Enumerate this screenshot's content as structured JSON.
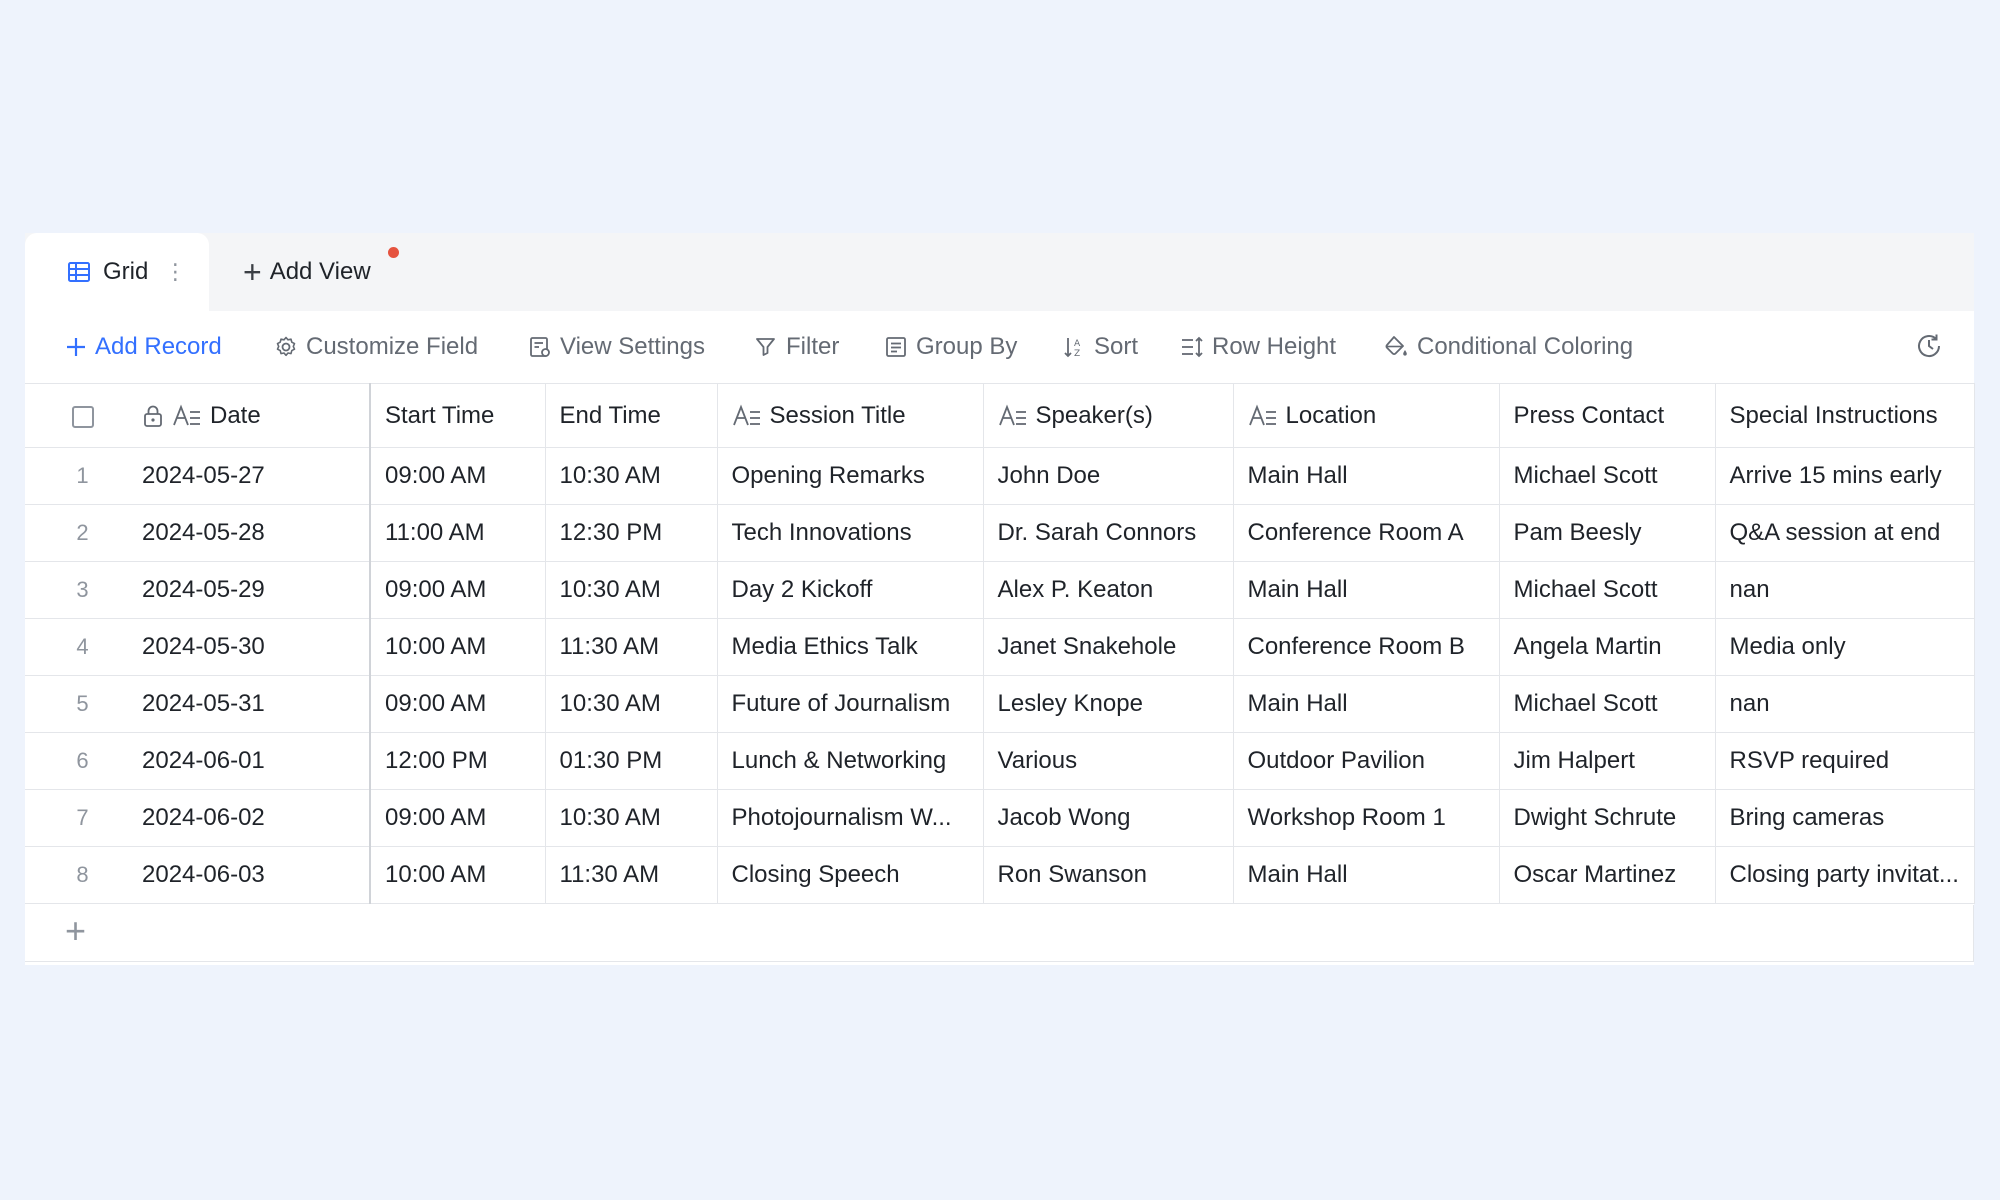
{
  "tabs": {
    "active_label": "Grid",
    "add_view_label": "Add View"
  },
  "toolbar": {
    "add_record": "Add Record",
    "customize_field": "Customize Field",
    "view_settings": "View Settings",
    "filter": "Filter",
    "group_by": "Group By",
    "sort": "Sort",
    "row_height": "Row Height",
    "conditional_coloring": "Conditional Coloring"
  },
  "columns": [
    "Date",
    "Start Time",
    "End Time",
    "Session Title",
    "Speaker(s)",
    "Location",
    "Press Contact",
    "Special Instructions"
  ],
  "rows": [
    {
      "num": "1",
      "cells": [
        "2024-05-27",
        "09:00 AM",
        "10:30 AM",
        "Opening Remarks",
        "John Doe",
        "Main Hall",
        "Michael Scott",
        "Arrive 15 mins early"
      ]
    },
    {
      "num": "2",
      "cells": [
        "2024-05-28",
        "11:00 AM",
        "12:30 PM",
        "Tech Innovations",
        "Dr. Sarah Connors",
        "Conference Room A",
        "Pam Beesly",
        "Q&A session at end"
      ]
    },
    {
      "num": "3",
      "cells": [
        "2024-05-29",
        "09:00 AM",
        "10:30 AM",
        "Day 2 Kickoff",
        "Alex P. Keaton",
        "Main Hall",
        "Michael Scott",
        "nan"
      ]
    },
    {
      "num": "4",
      "cells": [
        "2024-05-30",
        "10:00 AM",
        "11:30 AM",
        "Media Ethics Talk",
        "Janet Snakehole",
        "Conference Room B",
        "Angela Martin",
        "Media only"
      ]
    },
    {
      "num": "5",
      "cells": [
        "2024-05-31",
        "09:00 AM",
        "10:30 AM",
        "Future of Journalism",
        "Lesley Knope",
        "Main Hall",
        "Michael Scott",
        "nan"
      ]
    },
    {
      "num": "6",
      "cells": [
        "2024-06-01",
        "12:00 PM",
        "01:30 PM",
        "Lunch & Networking",
        "Various",
        "Outdoor Pavilion",
        "Jim Halpert",
        "RSVP required"
      ]
    },
    {
      "num": "7",
      "cells": [
        "2024-06-02",
        "09:00 AM",
        "10:30 AM",
        "Photojournalism W...",
        "Jacob Wong",
        "Workshop Room 1",
        "Dwight Schrute",
        "Bring cameras"
      ]
    },
    {
      "num": "8",
      "cells": [
        "2024-06-03",
        "10:00 AM",
        "11:30 AM",
        "Closing Speech",
        "Ron Swanson",
        "Main Hall",
        "Oscar Martinez",
        "Closing party invitat..."
      ]
    }
  ],
  "colors": {
    "accent": "#3370ff",
    "notification_dot": "#e5533f",
    "page_background": "#eef3fc"
  }
}
